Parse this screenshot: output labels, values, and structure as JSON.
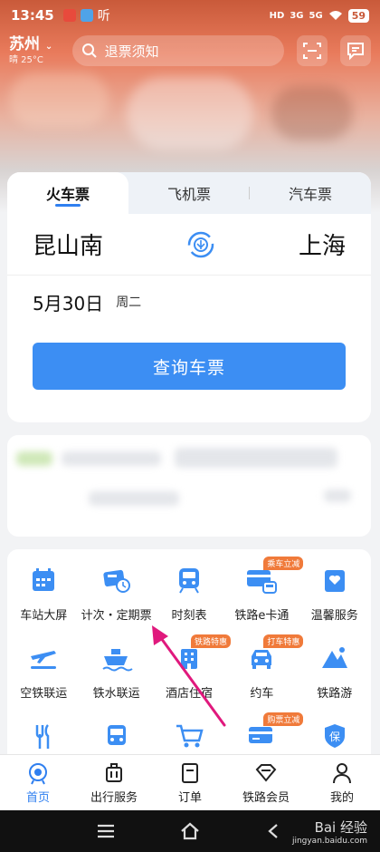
{
  "status": {
    "time": "13:45",
    "listen": "听",
    "network1": "HD",
    "network2": "3G",
    "network3": "5G",
    "battery": "59"
  },
  "header": {
    "city": "苏州",
    "weather": "晴 25°C",
    "search_placeholder": "退票须知"
  },
  "ticket_tabs": [
    "火车票",
    "飞机票",
    "汽车票"
  ],
  "route": {
    "from": "昆山南",
    "to": "上海",
    "date": "5月30日",
    "weekday": "周二",
    "query_label": "查询车票"
  },
  "services": [
    {
      "label": "车站大屏",
      "icon": "station-screen-icon",
      "badge": ""
    },
    {
      "label": "计次・定期票",
      "icon": "period-ticket-icon",
      "badge": ""
    },
    {
      "label": "时刻表",
      "icon": "timetable-train-icon",
      "badge": ""
    },
    {
      "label": "铁路e卡通",
      "icon": "rail-ecard-icon",
      "badge": "乘车立减"
    },
    {
      "label": "温馨服务",
      "icon": "care-service-icon",
      "badge": ""
    },
    {
      "label": "空铁联运",
      "icon": "air-rail-icon",
      "badge": ""
    },
    {
      "label": "铁水联运",
      "icon": "rail-ship-icon",
      "badge": ""
    },
    {
      "label": "酒店住宿",
      "icon": "hotel-icon",
      "badge": "铁路特惠"
    },
    {
      "label": "约车",
      "icon": "car-icon",
      "badge": "打车特惠"
    },
    {
      "label": "铁路游",
      "icon": "mountain-icon",
      "badge": ""
    },
    {
      "label": "",
      "icon": "food-icon",
      "badge": ""
    },
    {
      "label": "",
      "icon": "bus-icon",
      "badge": ""
    },
    {
      "label": "",
      "icon": "cart-icon",
      "badge": ""
    },
    {
      "label": "",
      "icon": "card-icon",
      "badge": "购票立减"
    },
    {
      "label": "",
      "icon": "insurance-icon",
      "badge": "",
      "glyph": "保"
    }
  ],
  "bottom_nav": [
    {
      "label": "首页",
      "icon": "home-icon",
      "active": true
    },
    {
      "label": "出行服务",
      "icon": "luggage-icon",
      "active": false
    },
    {
      "label": "订单",
      "icon": "order-icon",
      "active": false
    },
    {
      "label": "铁路会员",
      "icon": "diamond-icon",
      "active": false
    },
    {
      "label": "我的",
      "icon": "user-icon",
      "active": false
    }
  ],
  "watermark": {
    "main": "Bai 经验",
    "sub": "jingyan.baidu.com"
  },
  "colors": {
    "accent": "#3c8ef3",
    "arrow": "#e0197d",
    "badge": "#f07a3a"
  }
}
